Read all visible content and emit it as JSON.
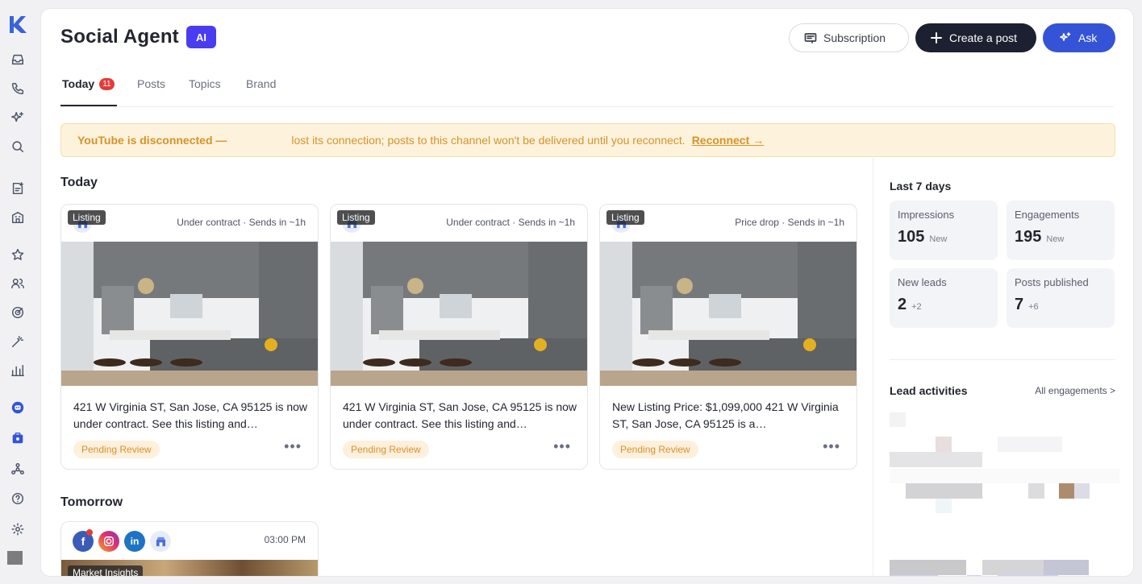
{
  "sidebar": {
    "items": [
      {
        "icon": "logo-icon"
      },
      {
        "icon": "inbox-icon"
      },
      {
        "icon": "phone-icon"
      },
      {
        "icon": "sparkles-icon"
      },
      {
        "icon": "search-icon"
      },
      {
        "icon": "document-add-icon"
      },
      {
        "icon": "building-icon"
      },
      {
        "icon": "star-icon"
      },
      {
        "icon": "people-icon"
      },
      {
        "icon": "target-icon"
      },
      {
        "icon": "magic-wand-icon"
      },
      {
        "icon": "bar-chart-icon"
      },
      {
        "icon": "social-agent-icon"
      },
      {
        "icon": "briefcase-icon"
      },
      {
        "icon": "network-icon"
      },
      {
        "icon": "help-icon"
      },
      {
        "icon": "settings-icon"
      },
      {
        "icon": "avatar-icon"
      }
    ]
  },
  "header": {
    "title": "Social Agent",
    "ai_badge": "AI",
    "subscription_label": "Subscription",
    "create_label": "Create a post",
    "ask_label": "Ask"
  },
  "tabs": [
    {
      "label": "Today",
      "count": "11"
    },
    {
      "label": "Posts"
    },
    {
      "label": "Topics"
    },
    {
      "label": "Brand"
    }
  ],
  "banner": {
    "title": "YouTube is disconnected —",
    "message": "lost its connection; posts to this channel won't be delivered until you reconnect.",
    "link": "Reconnect →"
  },
  "today": {
    "heading": "Today",
    "cards": [
      {
        "status": "Under contract · Sends in ~1h",
        "tag": "Listing",
        "text": "421 W Virginia ST, San Jose, CA 95125 is now under contract. See this listing and…",
        "review": "Pending Review"
      },
      {
        "status": "Under contract · Sends in ~1h",
        "tag": "Listing",
        "text": "421 W Virginia ST, San Jose, CA 95125 is now under contract. See this listing and…",
        "review": "Pending Review"
      },
      {
        "status": "Price drop · Sends in ~1h",
        "tag": "Listing",
        "text": "New Listing Price: $1,099,000 421 W Virginia ST, San Jose, CA 95125 is a…",
        "review": "Pending Review"
      }
    ]
  },
  "tomorrow": {
    "heading": "Tomorrow",
    "time": "03:00 PM",
    "tag": "Market Insights",
    "channels": [
      "facebook-icon",
      "instagram-icon",
      "linkedin-icon",
      "google-business-icon"
    ]
  },
  "stats": {
    "heading": "Last 7 days",
    "items": [
      {
        "label": "Impressions",
        "value": "105",
        "delta": "New"
      },
      {
        "label": "Engagements",
        "value": "195",
        "delta": "New"
      },
      {
        "label": "New leads",
        "value": "2",
        "delta": "+2"
      },
      {
        "label": "Posts published",
        "value": "7",
        "delta": "+6"
      }
    ]
  },
  "lead_activities": {
    "heading": "Lead activities",
    "link": "All engagements >"
  },
  "colors": {
    "accent": "#3553d6",
    "dark": "#1c2030",
    "ai_badge": "#4a3cf0",
    "warning_bg": "#fdf3dc",
    "warning_text": "#d7922a",
    "badge_red": "#e23b3b"
  }
}
